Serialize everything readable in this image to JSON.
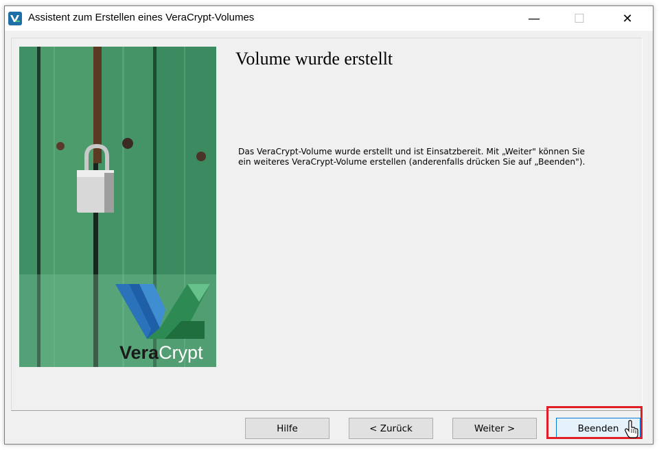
{
  "window": {
    "title": "Assistent zum Erstellen eines VeraCrypt-Volumes",
    "minimize_glyph": "—",
    "maximize_glyph": "☐",
    "close_glyph": "✕"
  },
  "banner": {
    "logo_text_bold": "Vera",
    "logo_text_light": "Crypt"
  },
  "main": {
    "heading": "Volume wurde erstellt",
    "line1": "Das VeraCrypt-Volume wurde erstellt und ist Einsatzbereit. Mit „Weiter\" können Sie",
    "line2": "ein weiteres VeraCrypt-Volume erstellen (anderenfalls drücken Sie auf „Beenden\")."
  },
  "buttons": {
    "help": "Hilfe",
    "back": "< Zurück",
    "next": "Weiter >",
    "finish": "Beenden"
  },
  "icons": {
    "app": "veracrypt-app-icon",
    "cursor": "mouse-pointer-icon",
    "padlock": "padlock-icon"
  },
  "colors": {
    "highlight": "#e01e26",
    "finish_border": "#0078d7",
    "banner_green": "#3b8d5e"
  }
}
